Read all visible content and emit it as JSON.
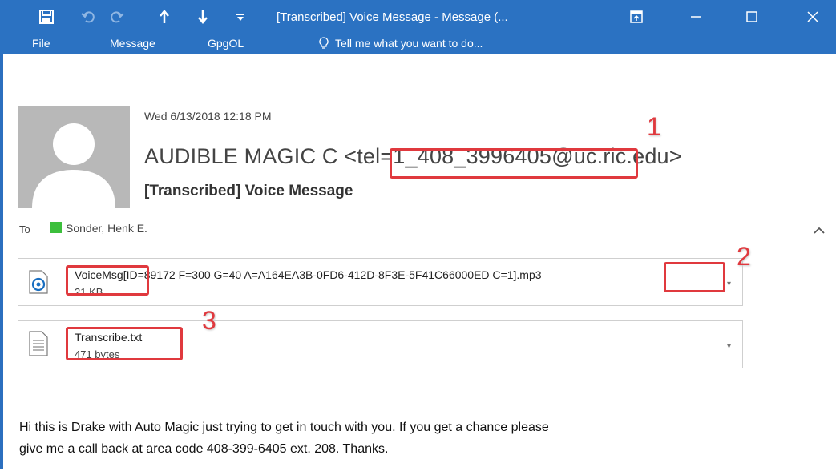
{
  "window": {
    "title": "[Transcribed] Voice Message - Message (...",
    "icons": [
      "save-icon",
      "undo-icon",
      "redo-icon",
      "up-arrow-icon",
      "down-arrow-icon",
      "customize-icon",
      "ribbon-display-icon",
      "minimize-icon",
      "maximize-icon",
      "close-icon"
    ]
  },
  "menu": {
    "file": "File",
    "message": "Message",
    "gpgol": "GpgOL",
    "tell_me": "Tell me what you want to do..."
  },
  "header": {
    "date": "Wed 6/13/2018 12:18 PM",
    "sender": "AUDIBLE MAGIC C <tel=1_408_3996405@uc.ric.edu>",
    "subject": "[Transcribed] Voice Message",
    "to_label": "To",
    "to_name": "Sonder, Henk E."
  },
  "attachments": [
    {
      "name": "VoiceMsg[ID=89172 F=300 G=40 A=A164EA3B-0FD6-412D-8F3E-5F41C66000ED C=1].mp3",
      "size": "21 KB",
      "icon": "audio-file-icon"
    },
    {
      "name": "Transcribe.txt",
      "size": "471 bytes",
      "icon": "text-file-icon"
    }
  ],
  "annotations": [
    "1",
    "2",
    "3"
  ],
  "body": {
    "line1": "Hi this is Drake with Auto Magic just trying to get in touch with you. If you get a chance please",
    "line2": "give me a call back at area code 408-399-6405 ext. 208. Thanks."
  },
  "colors": {
    "titlebar": "#2b72c2",
    "highlight": "#e0393e",
    "recipient": "#3cbf3c"
  }
}
